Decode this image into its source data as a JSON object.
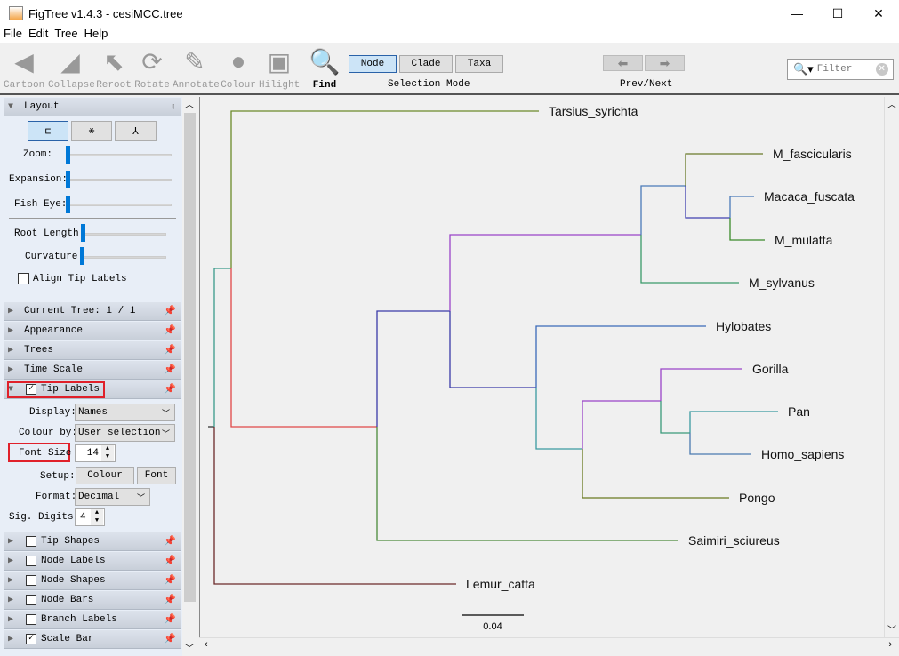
{
  "window": {
    "title": "FigTree v1.4.3 - cesiMCC.tree",
    "minimize": "—",
    "maximize": "☐",
    "close": "✕"
  },
  "menu": [
    "File",
    "Edit",
    "Tree",
    "Help"
  ],
  "toolbar": {
    "tools": [
      {
        "label": "Cartoon",
        "icon": "cartoon-icon",
        "enabled": false
      },
      {
        "label": "Collapse",
        "icon": "collapse-icon",
        "enabled": false
      },
      {
        "label": "Reroot",
        "icon": "reroot-icon",
        "enabled": false
      },
      {
        "label": "Rotate",
        "icon": "rotate-icon",
        "enabled": false
      },
      {
        "label": "Annotate",
        "icon": "paperclip-icon",
        "enabled": false
      },
      {
        "label": "Colour",
        "icon": "colour-icon",
        "enabled": false
      },
      {
        "label": "Hilight",
        "icon": "hilight-icon",
        "enabled": false
      },
      {
        "label": "Find",
        "icon": "magnifier-icon",
        "enabled": true
      }
    ],
    "selection_mode": {
      "label": "Selection Mode",
      "options": [
        "Node",
        "Clade",
        "Taxa"
      ],
      "selected": "Node"
    },
    "prev_next": {
      "label": "Prev/Next"
    },
    "filter": {
      "placeholder": "Filter",
      "value": ""
    }
  },
  "panel": {
    "layout": {
      "title": "Layout",
      "zoom": "Zoom:",
      "expansion": "Expansion:",
      "fish_eye": "Fish Eye:",
      "root_length": "Root Length:",
      "curvature": "Curvature:",
      "align_tip_labels": "Align Tip Labels",
      "align_checked": false
    },
    "sections_top": [
      {
        "title": "Current Tree: 1 / 1"
      },
      {
        "title": "Appearance"
      },
      {
        "title": "Trees"
      },
      {
        "title": "Time Scale"
      }
    ],
    "tip_labels": {
      "title": "Tip Labels",
      "checked": true,
      "display_label": "Display:",
      "display_value": "Names",
      "colour_by_label": "Colour by:",
      "colour_by_value": "User selection",
      "font_size_label": "Font Size",
      "font_size_value": "14",
      "setup_label": "Setup:",
      "colour_button": "Colour",
      "font_button": "Font",
      "format_label": "Format:",
      "format_value": "Decimal",
      "sig_digits_label": "Sig. Digits:",
      "sig_digits_value": "4"
    },
    "sections_bottom": [
      {
        "title": "Tip Shapes",
        "checked": false
      },
      {
        "title": "Node Labels",
        "checked": false
      },
      {
        "title": "Node Shapes",
        "checked": false
      },
      {
        "title": "Node Bars",
        "checked": false
      },
      {
        "title": "Branch Labels",
        "checked": false
      },
      {
        "title": "Scale Bar",
        "checked": true
      }
    ]
  },
  "tree": {
    "taxa": [
      {
        "name": "Tarsius_syrichta",
        "color": "#6b8a2a"
      },
      {
        "name": "M_fascicularis",
        "color": "#6a7a2a"
      },
      {
        "name": "Macaca_fuscata",
        "color": "#4a7ab8"
      },
      {
        "name": "M_mulatta",
        "color": "#3a8a2a"
      },
      {
        "name": "M_sylvanus",
        "color": "#3a9a6a"
      },
      {
        "name": "Hylobates",
        "color": "#3a6ab8"
      },
      {
        "name": "Gorilla",
        "color": "#9a44c8"
      },
      {
        "name": "Pan",
        "color": "#3a9aa0"
      },
      {
        "name": "Homo_sapiens",
        "color": "#4a7ab0"
      },
      {
        "name": "Pongo",
        "color": "#6a7a20"
      },
      {
        "name": "Saimiri_sciureus",
        "color": "#4a8a3a"
      },
      {
        "name": "Lemur_catta",
        "color": "#6b2a2a"
      }
    ],
    "internal_branch_colors": {
      "A": "#3a9a8a",
      "B": "#e04848",
      "C": "#3a3aa8",
      "D": "#9a44c8",
      "E": "#4a7ab8",
      "F": "#4040b0",
      "G": "#3a3aa8",
      "H": "#3a9aa0",
      "I": "#9a44c8",
      "J": "#3a9a7a"
    },
    "scale_bar": "0.04"
  }
}
